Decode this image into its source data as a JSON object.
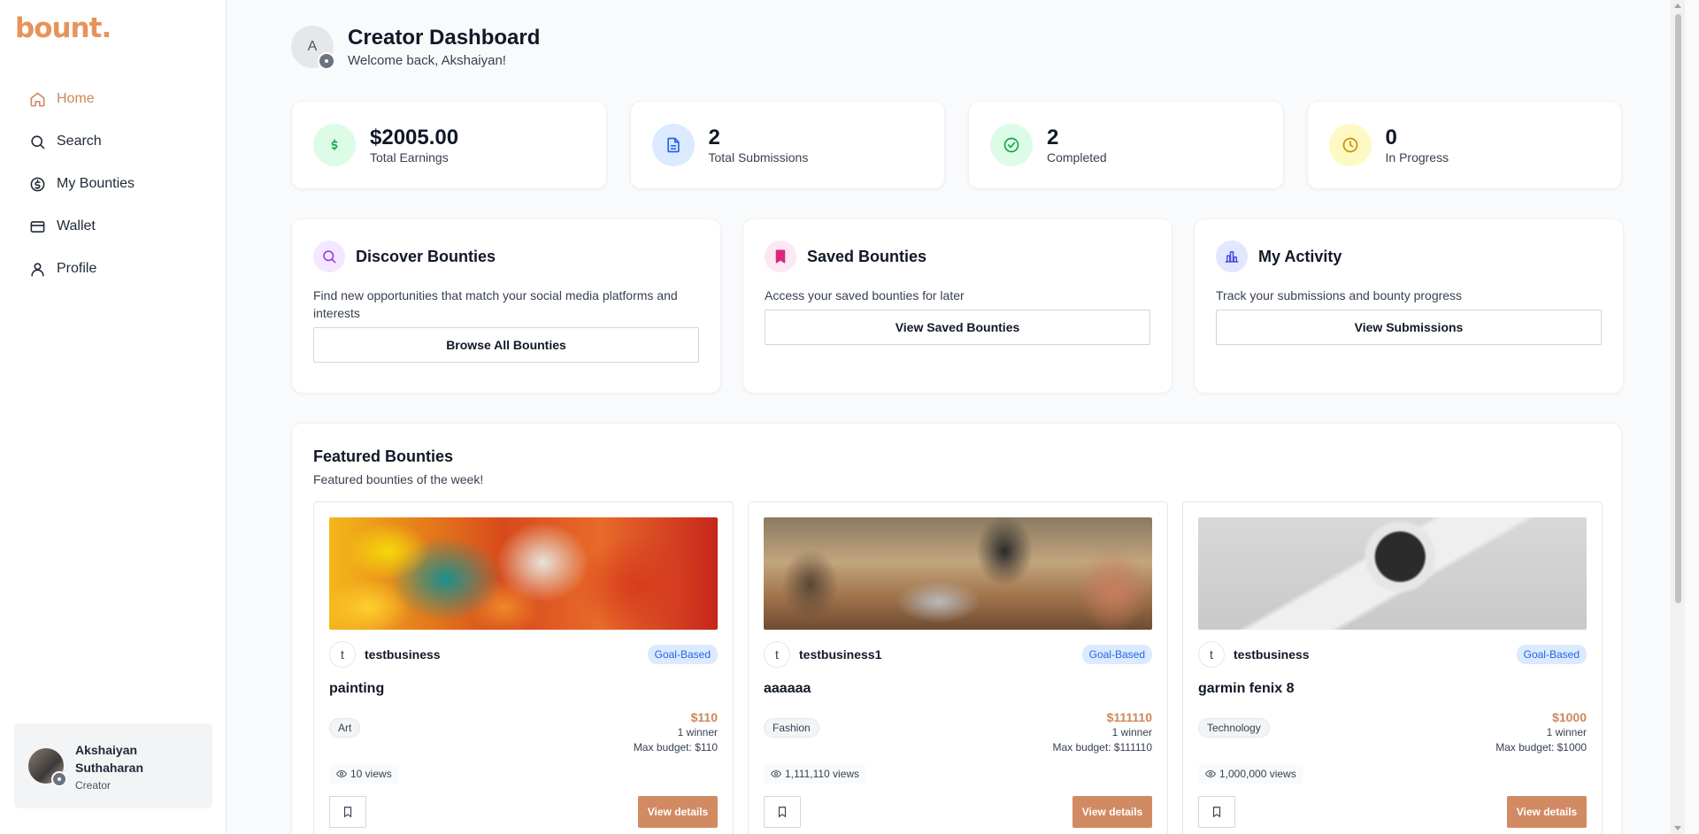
{
  "brand": {
    "logo": "bount."
  },
  "sidebar": {
    "items": [
      {
        "label": "Home",
        "icon": "home-icon"
      },
      {
        "label": "Search",
        "icon": "search-icon"
      },
      {
        "label": "My Bounties",
        "icon": "dollar-circle-icon"
      },
      {
        "label": "Wallet",
        "icon": "wallet-icon"
      },
      {
        "label": "Profile",
        "icon": "user-icon"
      }
    ],
    "active": "Home",
    "user": {
      "name": "Akshaiyan Suthaharan",
      "role": "Creator"
    }
  },
  "header": {
    "avatar_initial": "A",
    "title": "Creator Dashboard",
    "subtitle": "Welcome back, Akshaiyan!"
  },
  "stats": [
    {
      "value": "$2005.00",
      "label": "Total Earnings",
      "icon": "dollar-icon",
      "color": "#16a34a"
    },
    {
      "value": "2",
      "label": "Total Submissions",
      "icon": "document-icon",
      "color": "#2563eb"
    },
    {
      "value": "2",
      "label": "Completed",
      "icon": "check-circle-icon",
      "color": "#16a34a"
    },
    {
      "value": "0",
      "label": "In Progress",
      "icon": "clock-icon",
      "color": "#ca8a04"
    }
  ],
  "cards": [
    {
      "title": "Discover Bounties",
      "desc": "Find new opportunities that match your social media platforms and interests",
      "button": "Browse All Bounties",
      "icon": "search-icon"
    },
    {
      "title": "Saved Bounties",
      "desc": "Access your saved bounties for later",
      "button": "View Saved Bounties",
      "icon": "bookmark-icon"
    },
    {
      "title": "My Activity",
      "desc": "Track your submissions and bounty progress",
      "button": "View Submissions",
      "icon": "bar-chart-icon"
    }
  ],
  "featured": {
    "title": "Featured Bounties",
    "subtitle": "Featured bounties of the week!",
    "bounties": [
      {
        "business_initial": "t",
        "business": "testbusiness",
        "badge": "Goal-Based",
        "title": "painting",
        "tag": "Art",
        "price": "$110",
        "winners": "1 winner",
        "max_budget": "Max budget: $110",
        "views": "10 views",
        "view_label": "View details"
      },
      {
        "business_initial": "t",
        "business": "testbusiness1",
        "badge": "Goal-Based",
        "title": "aaaaaa",
        "tag": "Fashion",
        "price": "$111110",
        "winners": "1 winner",
        "max_budget": "Max budget: $111110",
        "views": "1,111,110 views",
        "view_label": "View details"
      },
      {
        "business_initial": "t",
        "business": "testbusiness",
        "badge": "Goal-Based",
        "title": "garmin fenix 8",
        "tag": "Technology",
        "price": "$1000",
        "winners": "1 winner",
        "max_budget": "Max budget: $1000",
        "views": "1,000,000 views",
        "view_label": "View details"
      }
    ]
  },
  "colors": {
    "accent": "#d0865a",
    "badge_bg": "#dbeafe",
    "badge_text": "#2563eb"
  }
}
